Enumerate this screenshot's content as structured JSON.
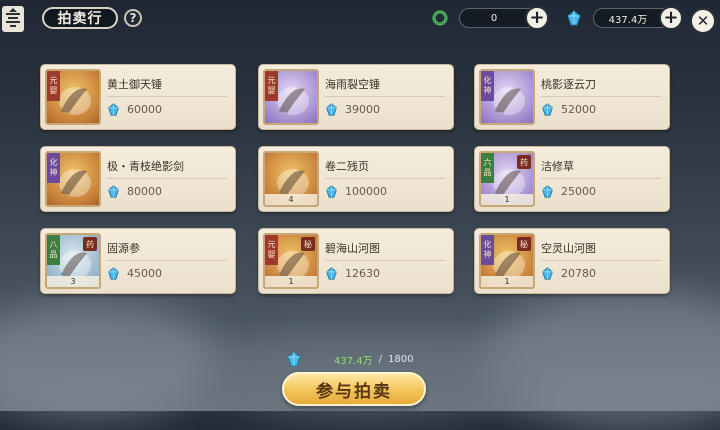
{
  "header": {
    "title": "拍卖行",
    "help_glyph": "?",
    "currency_left": {
      "value": "0",
      "icon": "jade-ring-icon"
    },
    "currency_right": {
      "value": "437.4万",
      "icon": "spirit-stone-icon"
    },
    "close_glyph": "✕"
  },
  "items": [
    {
      "name": "黄土御天锤",
      "price": "60000",
      "rank": [
        "元",
        "婴"
      ],
      "tag": "",
      "qty": "",
      "style": "gold"
    },
    {
      "name": "海雨裂空锤",
      "price": "39000",
      "rank": [
        "元",
        "婴"
      ],
      "tag": "",
      "qty": "",
      "style": "purple"
    },
    {
      "name": "桃影逐云刀",
      "price": "52000",
      "rank": [
        "化",
        "神"
      ],
      "tag": "",
      "qty": "",
      "style": "purple"
    },
    {
      "name": "极・青枝绝影剑",
      "price": "80000",
      "rank": [
        "化",
        "神"
      ],
      "tag": "",
      "qty": "",
      "style": "gold"
    },
    {
      "name": "卷二残页",
      "price": "100000",
      "rank": [],
      "tag": "",
      "qty": "4",
      "style": "gold"
    },
    {
      "name": "洁修草",
      "price": "25000",
      "rank": [
        "六",
        "品"
      ],
      "tag": "药",
      "qty": "1",
      "style": "purple"
    },
    {
      "name": "固源参",
      "price": "45000",
      "rank": [
        "八",
        "品"
      ],
      "tag": "药",
      "qty": "3",
      "style": "blue"
    },
    {
      "name": "碧海山河图",
      "price": "12630",
      "rank": [
        "元",
        "婴"
      ],
      "tag": "秘",
      "qty": "1",
      "style": "gold"
    },
    {
      "name": "空灵山河图",
      "price": "20780",
      "rank": [
        "化",
        "神"
      ],
      "tag": "秘",
      "qty": "1",
      "style": "gold"
    }
  ],
  "footer": {
    "have": "437.4万",
    "separator": "/",
    "need": "1800",
    "button_label": "参与拍卖"
  },
  "colors": {
    "accent_gold": "#f2c45a",
    "balance_green": "#8ee06c",
    "card_bg": "#f4ecdc"
  }
}
